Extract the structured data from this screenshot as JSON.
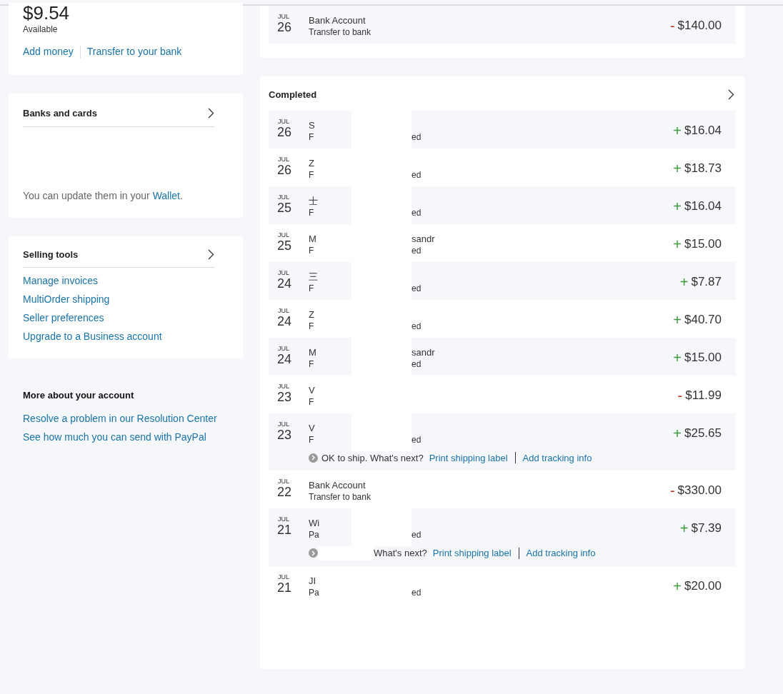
{
  "balance": {
    "amount": "$9.54",
    "label": "Available",
    "links": [
      "Add money",
      "Transfer to your bank"
    ]
  },
  "banks": {
    "title": "Banks and cards",
    "note_before": "You can update them in your",
    "note_link": "Wallet",
    "note_after": "."
  },
  "selling_tools": {
    "title": "Selling tools",
    "links": [
      "Manage invoices",
      "MultiOrder shipping",
      "Seller preferences",
      "Upgrade to a Business account"
    ]
  },
  "more": {
    "title": "More about your account",
    "links": [
      "Resolve a problem in our Resolution Center",
      "See how much you can send with PayPal"
    ]
  },
  "pending": [
    {
      "month": "JUL",
      "day": "26",
      "name": "Bank Account",
      "detail": "Transfer to bank",
      "sign": "-",
      "amount": "$140.00"
    }
  ],
  "completed": {
    "title": "Completed",
    "rows": [
      {
        "month": "JUL",
        "day": "26",
        "name": "S",
        "detail": "F",
        "detail_end": "ed",
        "sign": "+",
        "amount": "$16.04",
        "kind": "redacted"
      },
      {
        "month": "JUL",
        "day": "26",
        "name": "Z",
        "detail": "F",
        "detail_end": "ed",
        "sign": "+",
        "amount": "$18.73",
        "kind": "redacted"
      },
      {
        "month": "JUL",
        "day": "25",
        "name": "士",
        "detail": "F",
        "detail_end": "ed",
        "sign": "+",
        "amount": "$16.04",
        "kind": "redacted"
      },
      {
        "month": "JUL",
        "day": "25",
        "name": "M",
        "name_end": "sandr",
        "detail": "F",
        "detail_end": "ed",
        "sign": "+",
        "amount": "$15.00",
        "kind": "redacted"
      },
      {
        "month": "JUL",
        "day": "24",
        "name": "三",
        "detail": "F",
        "detail_end": "ed",
        "sign": "+",
        "amount": "$7.87",
        "kind": "redacted"
      },
      {
        "month": "JUL",
        "day": "24",
        "name": "Z",
        "detail": "F",
        "detail_end": "ed",
        "sign": "+",
        "amount": "$40.70",
        "kind": "redacted"
      },
      {
        "month": "JUL",
        "day": "24",
        "name": "M",
        "name_end": "sandr",
        "detail": "F",
        "detail_end": "ed",
        "sign": "+",
        "amount": "$15.00",
        "kind": "redacted"
      },
      {
        "month": "JUL",
        "day": "23",
        "name": "V",
        "detail": "F",
        "sign": "-",
        "amount": "$11.99",
        "kind": "redacted"
      },
      {
        "month": "JUL",
        "day": "23",
        "name": "V",
        "detail": "F",
        "detail_end": "ed",
        "sign": "+",
        "amount": "$25.65",
        "kind": "redacted",
        "ship": {
          "text": "OK to ship. What's next?",
          "links": [
            "Print shipping label",
            "Add tracking info"
          ]
        }
      },
      {
        "month": "JUL",
        "day": "22",
        "name": "Bank Account",
        "detail": "Transfer to bank",
        "sign": "-",
        "amount": "$330.00",
        "kind": "plain"
      },
      {
        "month": "JUL",
        "day": "21",
        "name": "Wi",
        "detail": "Pa",
        "detail_end": "ed",
        "sign": "+",
        "amount": "$7.39",
        "kind": "redacted",
        "ship": {
          "text": "What's next?",
          "links": [
            "Print shipping label",
            "Add tracking info"
          ],
          "covered": true
        }
      },
      {
        "month": "JUL",
        "day": "21",
        "name": "JI",
        "detail": "Pa",
        "detail_end": "ed",
        "sign": "+",
        "amount": "$20.00",
        "kind": "redacted"
      }
    ]
  }
}
